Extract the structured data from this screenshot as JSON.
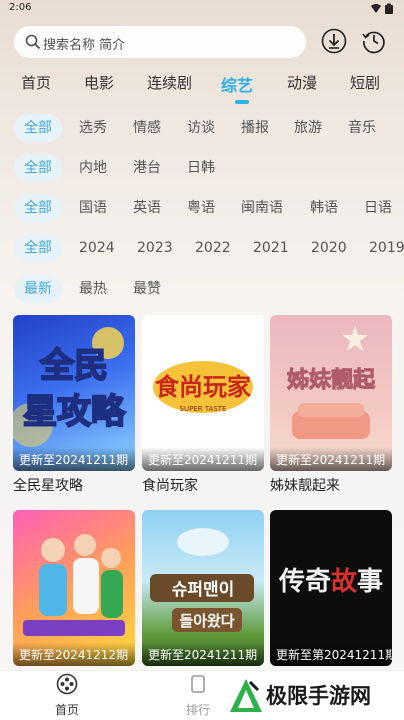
{
  "status_bar": {
    "time": "2:06"
  },
  "search": {
    "placeholder": "搜索名称 简介"
  },
  "categories": [
    "首页",
    "电影",
    "连续剧",
    "综艺",
    "动漫",
    "短剧"
  ],
  "active_category": "综艺",
  "filters": {
    "type": [
      "全部",
      "选秀",
      "情感",
      "访谈",
      "播报",
      "旅游",
      "音乐"
    ],
    "region": [
      "全部",
      "内地",
      "港台",
      "日韩"
    ],
    "language": [
      "全部",
      "国语",
      "英语",
      "粤语",
      "闽南语",
      "韩语",
      "日语"
    ],
    "year": [
      "全部",
      "2024",
      "2023",
      "2022",
      "2021",
      "2020",
      "2019"
    ],
    "sort": [
      "最新",
      "最热",
      "最赞"
    ]
  },
  "items": [
    {
      "title": "全民星攻略",
      "episode": "更新至20241211期",
      "poster_text": "全民星攻略",
      "colors": [
        "#2b4fd6",
        "#6bc3f7"
      ]
    },
    {
      "title": "食尚玩家",
      "episode": "更新至20241211期",
      "poster_text": "食尚玩家",
      "poster_sub": "SUPER TASTE",
      "colors": [
        "#ffffff",
        "#f2f2f2"
      ]
    },
    {
      "title": "姊妹靓起来",
      "episode": "更新至20241211期",
      "poster_text": "姊妹靓起来",
      "colors": [
        "#e8a8b4",
        "#f6d4c8"
      ]
    },
    {
      "title": "",
      "episode": "更新至20241212期",
      "poster_text": "",
      "colors": [
        "#ff7ac4",
        "#ffd23c"
      ]
    },
    {
      "title": "",
      "episode": "更新至20241211期",
      "poster_text": "슈퍼맨이 돌아왔다",
      "colors": [
        "#6fb9ea",
        "#3d7a2f"
      ]
    },
    {
      "title": "",
      "episode": "更新至第20241211期",
      "poster_text": "传奇故事",
      "colors": [
        "#101010",
        "#2a2a2a"
      ]
    }
  ],
  "bottom_nav": [
    {
      "label": "首页",
      "icon": "home-film-icon"
    },
    {
      "label": "排行",
      "icon": "rank-icon"
    }
  ],
  "watermark": {
    "text": "极限手游网"
  }
}
